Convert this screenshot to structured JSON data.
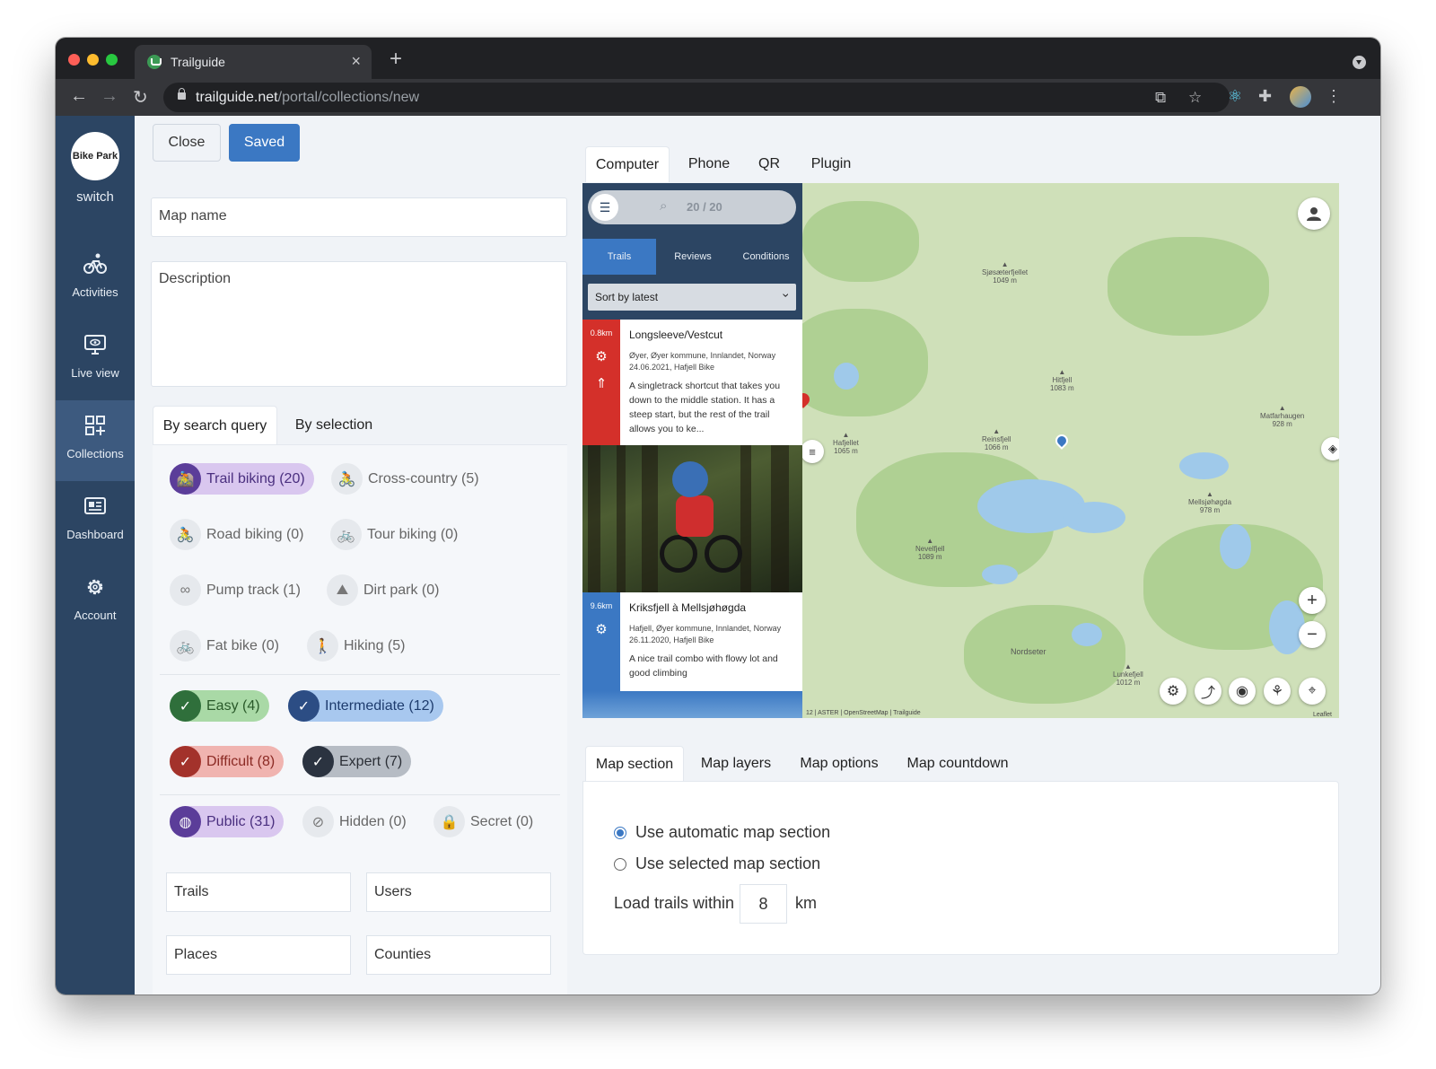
{
  "browser": {
    "tab_title": "Trailguide",
    "new_tab": "+",
    "close_tab": "×",
    "url_host": "trailguide.net",
    "url_path": "/portal/collections/new"
  },
  "sidebar": {
    "logo_text": "Bike Park",
    "switch_label": "switch",
    "items": [
      {
        "label": "Activities",
        "icon": "bike-icon"
      },
      {
        "label": "Live view",
        "icon": "monitor-eye-icon"
      },
      {
        "label": "Collections",
        "icon": "grid-plus-icon"
      },
      {
        "label": "Dashboard",
        "icon": "dashboard-icon"
      },
      {
        "label": "Account",
        "icon": "gear-icon"
      }
    ]
  },
  "form": {
    "close_label": "Close",
    "saved_label": "Saved",
    "map_name_placeholder": "Map name",
    "description_placeholder": "Description",
    "subtabs": [
      "By search query",
      "By selection"
    ],
    "activities": [
      "Trail biking (20)",
      "Cross-country (5)",
      "Road biking (0)",
      "Tour biking (0)",
      "Pump track (1)",
      "Dirt park (0)",
      "Fat bike (0)",
      "Hiking (5)"
    ],
    "difficulties": [
      "Easy (4)",
      "Intermediate (12)",
      "Difficult (8)",
      "Expert (7)"
    ],
    "visibility": [
      "Public (31)",
      "Hidden (0)",
      "Secret (0)"
    ],
    "fields": [
      "Trails",
      "Users",
      "Places",
      "Counties"
    ]
  },
  "preview": {
    "tabs": [
      "Computer",
      "Phone",
      "QR",
      "Plugin"
    ],
    "search_count": "20 / 20",
    "trail_tabs": [
      "Trails",
      "Reviews",
      "Conditions"
    ],
    "sort_label": "Sort by latest",
    "trails": [
      {
        "distance": "0.8km",
        "name": "Longsleeve/Vestcut",
        "location": "Øyer, Øyer kommune, Innlandet, Norway",
        "meta": "24.06.2021, Hafjell Bike",
        "description": "A singletrack shortcut that takes you down to the middle station. It has a steep start, but the rest of the trail allows you to ke...",
        "color": "#d4302a"
      },
      {
        "distance": "9.6km",
        "name": "Kriksfjell à Mellsjøhøgda",
        "location": "Hafjell, Øyer kommune, Innlandet, Norway",
        "meta": "26.11.2020, Hafjell Bike",
        "description": "A nice trail combo with flowy lot and good climbing",
        "color": "#3b78c3"
      }
    ],
    "map_labels": [
      {
        "name": "Sjøsæterfjellet",
        "elev": "1049 m"
      },
      {
        "name": "Hitfjell",
        "elev": "1083 m"
      },
      {
        "name": "Matfarhaugen",
        "elev": "928 m"
      },
      {
        "name": "Hafjellet",
        "elev": "1065 m"
      },
      {
        "name": "Reinsfjell",
        "elev": "1066 m"
      },
      {
        "name": "Mellsjøhøgda",
        "elev": "978 m"
      },
      {
        "name": "Nevelfjell",
        "elev": "1089 m"
      },
      {
        "name": "Nordseter",
        "elev": ""
      },
      {
        "name": "Lunkefjell",
        "elev": "1012 m"
      }
    ],
    "attribution": "12 | ASTER | OpenStreetMap | Trailguide",
    "leaflet": "Leaflet",
    "zoom_in": "+",
    "zoom_out": "−"
  },
  "map_settings": {
    "tabs": [
      "Map section",
      "Map layers",
      "Map options",
      "Map countdown"
    ],
    "option_auto": "Use automatic map section",
    "option_selected": "Use selected map section",
    "load_label": "Load trails within",
    "load_value": "8",
    "load_unit": "km"
  },
  "colors": {
    "sidebar": "#2c4563",
    "accent": "#3b78c3",
    "trail_red": "#d4302a"
  }
}
